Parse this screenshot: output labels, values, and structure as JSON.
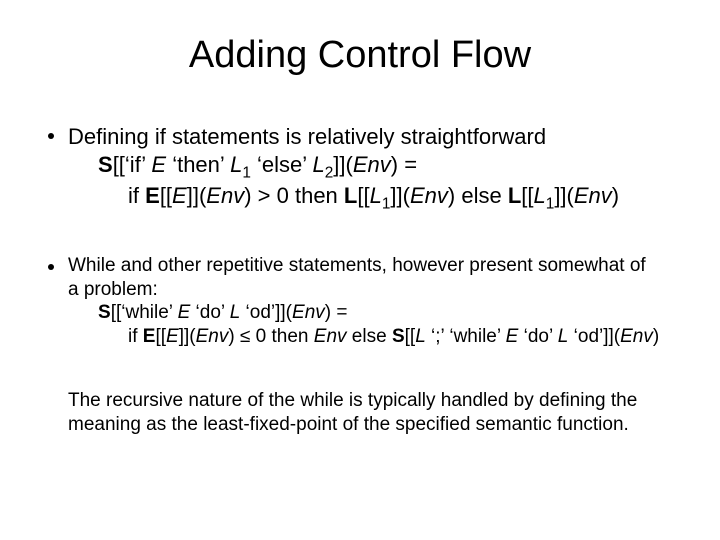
{
  "title": "Adding Control Flow",
  "bullet1": {
    "lead": "Defining if statements is relatively straightforward",
    "line2_pre": "S",
    "line2_open": "[[‘if’ ",
    "line2_E": "E",
    "line2_then": " ‘then’ ",
    "line2_L": "L",
    "line2_sub1": "1",
    "line2_else": " ‘else’ ",
    "line2_L2": "L",
    "line2_sub2": "2",
    "line2_close": "]](",
    "line2_Env": "Env",
    "line2_eq": ") =",
    "line3_if": "if ",
    "line3_E": "E",
    "line3_open": "[[",
    "line3_Ein": "E",
    "line3_cl": "]](",
    "line3_Env": "Env",
    "line3_gt": ") > 0 then ",
    "line3_L": "L",
    "line3_o2": "[[",
    "line3_L1": "L",
    "line3_s1": "1",
    "line3_c2": "]](",
    "line3_Env2": "Env",
    "line3_el": ") else ",
    "line3_Lb": "L",
    "line3_o3": "[[",
    "line3_L1b": "L",
    "line3_s1b": "1",
    "line3_c3": "]](",
    "line3_Env3": "Env",
    "line3_end": ")"
  },
  "bullet2": {
    "lead1": "While and other repetitive statements, however present somewhat of",
    "lead2": "a problem:",
    "line2_pre": "S",
    "line2_open": "[[‘while’ ",
    "line2_E": "E",
    "line2_do": " ‘do’ ",
    "line2_L": "L",
    "line2_od": " ‘od’]](",
    "line2_Env": "Env",
    "line2_eq": ") =",
    "line3_if": "if ",
    "line3_E": "E",
    "line3_op": "[[",
    "line3_Ein": "E",
    "line3_cl": "]](",
    "line3_Env": "Env",
    "line3_le": ") ≤ 0 then ",
    "line3_Env2": "Env",
    "line3_el": " else ",
    "line3_S": "S",
    "line3_op2": "[[",
    "line3_L": "L",
    "line3_mid": " ‘;’ ‘while’ ",
    "line3_E2": "E",
    "line3_do": " ‘do’ ",
    "line3_L2": "L",
    "line3_od": " ‘od’]](",
    "line3_Env3": "Env",
    "line3_end": ")"
  },
  "trailer1": "The recursive nature of the while is typically handled by defining the",
  "trailer2": "meaning as the least-fixed-point of the specified semantic function."
}
